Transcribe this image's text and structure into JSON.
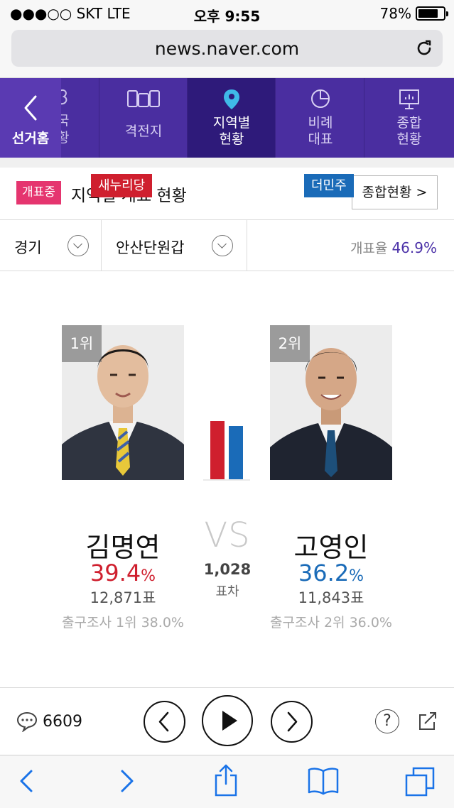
{
  "status_bar": {
    "carrier": "●●●○○ SKT   LTE",
    "time": "오후 9:55",
    "battery_pct": "78%",
    "battery_level": 0.78
  },
  "browser": {
    "url": "news.naver.com"
  },
  "nav": {
    "home_label": "선거홈",
    "partial_label": "국\n황",
    "tabs": [
      {
        "label": "격전지",
        "icon": "books-icon",
        "active": false
      },
      {
        "label": "지역별\n현황",
        "icon": "location-pin-icon",
        "active": true
      },
      {
        "label": "비례\n대표",
        "icon": "pie-chart-icon",
        "active": false
      },
      {
        "label": "종합\n현황",
        "icon": "board-chart-icon",
        "active": false
      }
    ]
  },
  "header": {
    "live_badge": "개표중",
    "title": "지역별 개표 현황",
    "summary_button": "종합현황 >"
  },
  "filters": {
    "region": "경기",
    "district": "안산단원갑",
    "rate_label": "개표율",
    "rate_value": "46.9%"
  },
  "colors": {
    "nav_purple": "#4a2ea0",
    "saenuri_red": "#cf1f2e",
    "minju_blue": "#1a6bb8",
    "badge_pink": "#e5356f"
  },
  "candidates": [
    {
      "rank": "1위",
      "party": "새누리당",
      "party_color": "#cf1f2e",
      "name": "김명연",
      "pct": "39.4",
      "pct_unit": "%",
      "votes": "12,871표",
      "exit_poll": "출구조사 1위 38.0%"
    },
    {
      "rank": "2위",
      "party": "더민주",
      "party_color": "#1a6bb8",
      "name": "고영인",
      "pct": "36.2",
      "pct_unit": "%",
      "votes": "11,843표",
      "exit_poll": "출구조사 2위 36.0%"
    }
  ],
  "versus": {
    "vs": "VS",
    "diff": "1,028",
    "diff_unit": "표차",
    "bar_values": [
      39.4,
      36.2
    ]
  },
  "controls": {
    "comment_count": "6609",
    "help": "?"
  }
}
